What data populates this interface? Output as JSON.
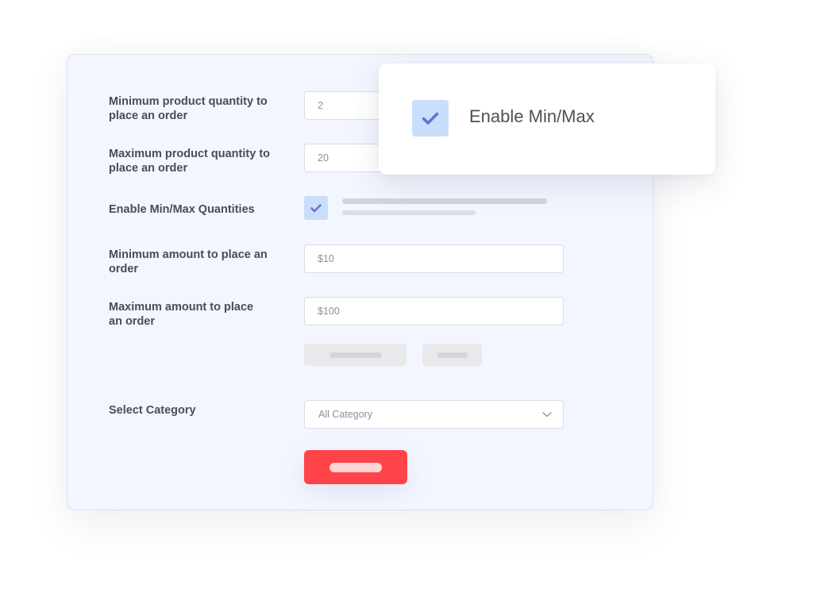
{
  "form": {
    "fields": [
      {
        "label": "Minimum product quantity to place an order",
        "value": "2"
      },
      {
        "label": "Maximum product quantity to place an order",
        "value": "20"
      },
      {
        "label": "Enable Min/Max Quantities",
        "checked": true
      },
      {
        "label": "Minimum amount to place an order",
        "value": "$10"
      },
      {
        "label": "Maximum amount to place an order",
        "value": "$100"
      }
    ],
    "category": {
      "label": "Select Category",
      "value": "All Category"
    }
  },
  "popup": {
    "label": "Enable Min/Max",
    "checked": true
  },
  "icons": {
    "checkbox": "check-icon",
    "select": "chevron-down-icon"
  },
  "colors": {
    "accent": "#fe4449",
    "checkbox_bg": "#c9defb",
    "check_mark": "#6672d6",
    "panel_bg": "#f3f6fe"
  }
}
